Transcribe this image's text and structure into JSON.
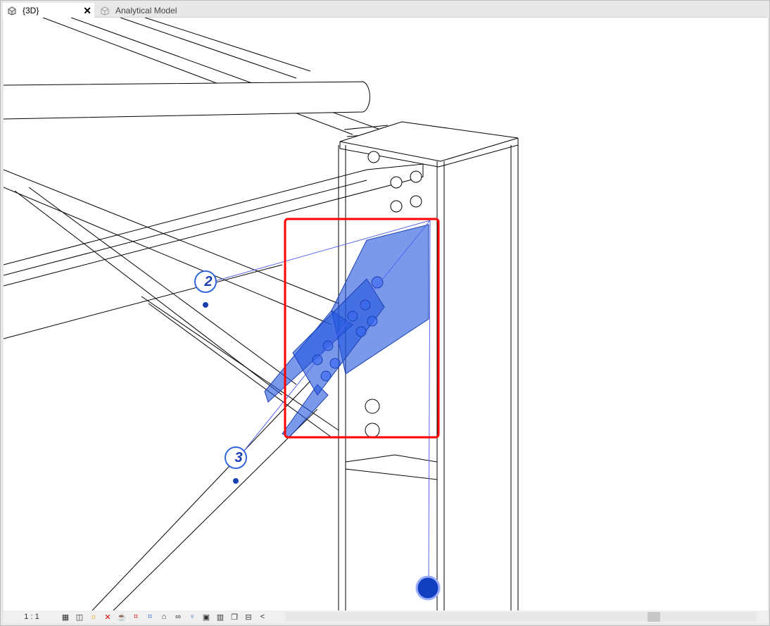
{
  "tabs": [
    {
      "label": "{3D}",
      "active": true,
      "close_label": "✕"
    },
    {
      "label": "Analytical Model",
      "active": false
    }
  ],
  "view": {
    "tags": [
      {
        "label": "2"
      },
      {
        "label": "3"
      }
    ],
    "highlight_color": "#ff0000",
    "selection_color": "#2255dd"
  },
  "status": {
    "scale": "1 : 1",
    "icons": [
      "detail-level-icon",
      "visual-style-icon",
      "sun-path-off-icon",
      "shadows-off-icon",
      "render-icon",
      "crop-view-off-icon",
      "show-crop-icon",
      "unlock-3d-icon",
      "temporary-hide-icon",
      "reveal-hidden-icon",
      "worksharing-icon",
      "analytical-model-icon",
      "highlight-displacement-icon",
      "constraints-icon"
    ],
    "collapse": "<"
  }
}
